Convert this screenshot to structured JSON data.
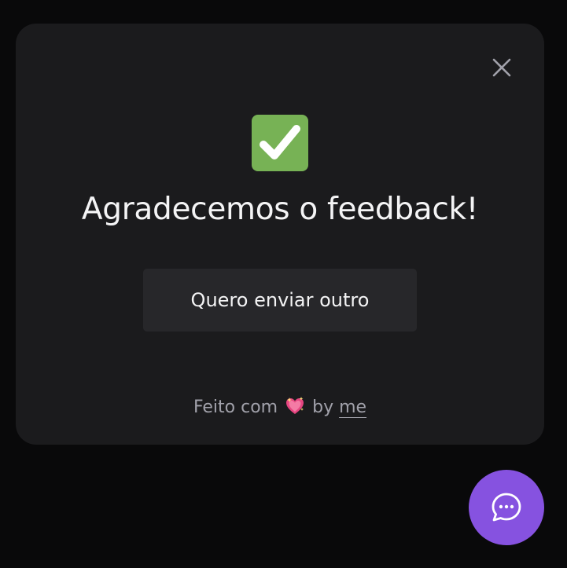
{
  "dialog": {
    "close_icon": "close-icon",
    "success_icon": "check-mark-button-icon",
    "title": "Agradecemos o feedback!",
    "send_another_label": "Quero enviar outro",
    "footer": {
      "prefix": "Feito com",
      "emoji_icon": "sparkling-heart-icon",
      "by": "by",
      "link_text": "me"
    }
  },
  "chat_button": {
    "icon": "chat-bubble-icon"
  },
  "colors": {
    "page_background": "#09090a",
    "card_background": "#1b1b1d",
    "button_background": "#27272a",
    "success_green": "#77b255",
    "brand_purple": "#8652e0",
    "text_primary": "#f4f4f5",
    "text_muted": "#a1a1aa"
  }
}
